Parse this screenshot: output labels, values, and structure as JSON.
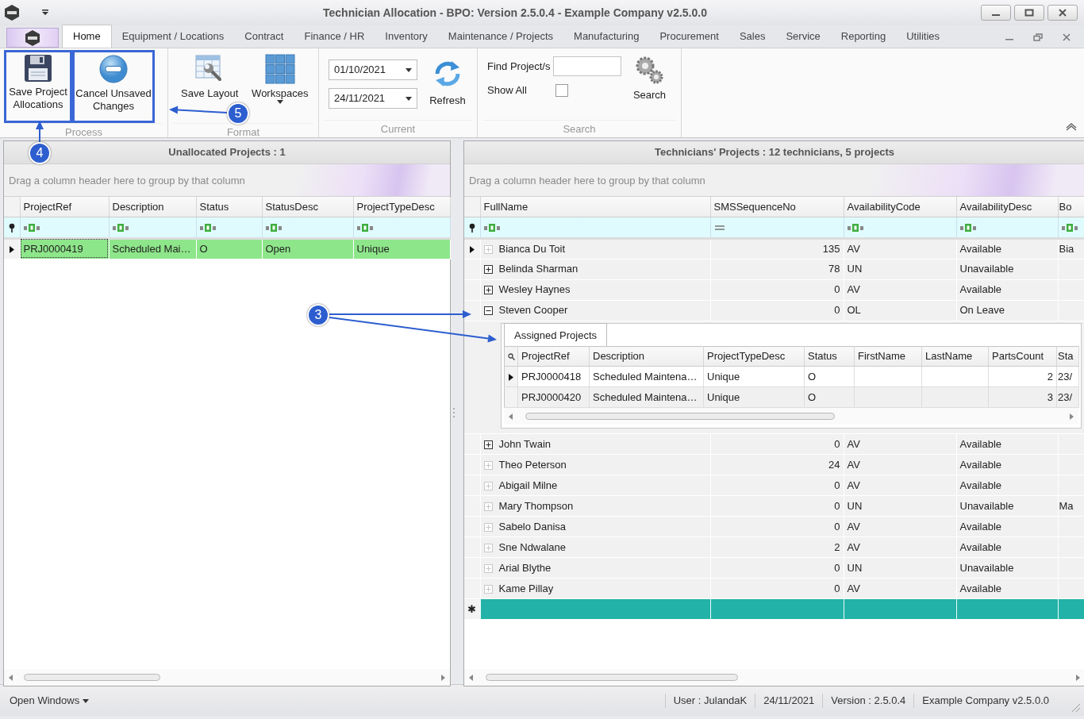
{
  "window": {
    "title": "Technician Allocation - BPO: Version 2.5.0.4 - Example Company v2.5.0.0"
  },
  "ribbon_tabs": [
    {
      "label": "Home",
      "selected": true
    },
    {
      "label": "Equipment / Locations",
      "selected": false
    },
    {
      "label": "Contract",
      "selected": false
    },
    {
      "label": "Finance / HR",
      "selected": false
    },
    {
      "label": "Inventory",
      "selected": false
    },
    {
      "label": "Maintenance / Projects",
      "selected": false
    },
    {
      "label": "Manufacturing",
      "selected": false
    },
    {
      "label": "Procurement",
      "selected": false
    },
    {
      "label": "Sales",
      "selected": false
    },
    {
      "label": "Service",
      "selected": false
    },
    {
      "label": "Reporting",
      "selected": false
    },
    {
      "label": "Utilities",
      "selected": false
    }
  ],
  "ribbon": {
    "process": {
      "label": "Process",
      "buttons": [
        {
          "kind": "save",
          "label": "Save Project Allocations",
          "highlighted": true
        },
        {
          "kind": "cancel",
          "label": "Cancel Unsaved Changes",
          "highlighted": true
        }
      ]
    },
    "format": {
      "label": "Format",
      "buttons": [
        {
          "kind": "layout",
          "label": "Save Layout",
          "dropdown": false
        },
        {
          "kind": "workspaces",
          "label": "Workspaces",
          "dropdown": true
        }
      ]
    },
    "current": {
      "label": "Current",
      "dates": [
        "01/10/2021",
        "24/11/2021"
      ],
      "refresh_label": "Refresh"
    },
    "search": {
      "label": "Search",
      "find_label": "Find Project/s",
      "show_all_label": "Show All",
      "show_all_checked": false,
      "search_label": "Search"
    }
  },
  "unallocated": {
    "caption": "Unallocated Projects : 1",
    "group_hint": "Drag a column header here to group by that column",
    "columns": [
      {
        "label": "ProjectRef",
        "kind": "text"
      },
      {
        "label": "Description",
        "kind": "text"
      },
      {
        "label": "Status",
        "kind": "text"
      },
      {
        "label": "StatusDesc",
        "kind": "text"
      },
      {
        "label": "ProjectTypeDesc",
        "kind": "text"
      }
    ],
    "rows": [
      {
        "selected": true,
        "cells": [
          "PRJ0000419",
          "Scheduled Mai…",
          "O",
          "Open",
          "Unique"
        ]
      }
    ]
  },
  "technicians": {
    "caption": "Technicians' Projects : 12 technicians, 5 projects",
    "group_hint": "Drag a column header here to group by that column",
    "columns": [
      {
        "label": "FullName",
        "kind": "text"
      },
      {
        "label": "SMSSequenceNo",
        "kind": "number"
      },
      {
        "label": "AvailabilityCode",
        "kind": "text"
      },
      {
        "label": "AvailabilityDesc",
        "kind": "text"
      },
      {
        "label": "Bo",
        "kind": "text"
      }
    ],
    "rows": [
      {
        "selected": true,
        "has_details": false,
        "expanded": false,
        "cells": [
          "Bianca Du Toit",
          "135",
          "AV",
          "Available",
          "Bia"
        ]
      },
      {
        "selected": false,
        "has_details": true,
        "expanded": false,
        "cells": [
          "Belinda Sharman",
          "78",
          "UN",
          "Unavailable",
          null
        ]
      },
      {
        "selected": false,
        "has_details": true,
        "expanded": false,
        "cells": [
          "Wesley Haynes",
          "0",
          "AV",
          "Available",
          null
        ]
      },
      {
        "selected": false,
        "has_details": true,
        "expanded": true,
        "cells": [
          "Steven Cooper",
          "0",
          "OL",
          "On Leave",
          null
        ],
        "details": {
          "tab": "Assigned Projects",
          "columns": [
            "ProjectRef",
            "Description",
            "ProjectTypeDesc",
            "Status",
            "FirstName",
            "LastName",
            "PartsCount",
            "Sta"
          ],
          "rows": [
            {
              "selected": true,
              "cells": [
                "PRJ0000418",
                "Scheduled Maintena…",
                "Unique",
                "O",
                null,
                null,
                "2",
                "23/"
              ]
            },
            {
              "selected": false,
              "cells": [
                "PRJ0000420",
                "Scheduled Maintena…",
                "Unique",
                "O",
                null,
                null,
                "3",
                "23/"
              ]
            }
          ]
        }
      },
      {
        "selected": false,
        "has_details": true,
        "expanded": false,
        "cells": [
          "John Twain",
          "0",
          "AV",
          "Available",
          null
        ]
      },
      {
        "selected": false,
        "has_details": false,
        "expanded": false,
        "cells": [
          "Theo Peterson",
          "24",
          "AV",
          "Available",
          null
        ]
      },
      {
        "selected": false,
        "has_details": false,
        "expanded": false,
        "cells": [
          "Abigail Milne",
          "0",
          "AV",
          "Available",
          null
        ]
      },
      {
        "selected": false,
        "has_details": false,
        "expanded": false,
        "cells": [
          "Mary Thompson",
          "0",
          "UN",
          "Unavailable",
          "Ma"
        ]
      },
      {
        "selected": false,
        "has_details": false,
        "expanded": false,
        "cells": [
          "Sabelo Danisa",
          "0",
          "AV",
          "Available",
          null
        ]
      },
      {
        "selected": false,
        "has_details": false,
        "expanded": false,
        "cells": [
          "Sne Ndwalane",
          "2",
          "AV",
          "Available",
          null
        ]
      },
      {
        "selected": false,
        "has_details": false,
        "expanded": false,
        "cells": [
          "Arial Blythe",
          "0",
          "UN",
          "Unavailable",
          null
        ]
      },
      {
        "selected": false,
        "has_details": false,
        "expanded": false,
        "cells": [
          "Kame Pillay",
          "0",
          "AV",
          "Available",
          null
        ]
      }
    ],
    "new_row_marker": "✱"
  },
  "status_bar": {
    "menu": "Open Windows",
    "items": [
      "User : JulandaK",
      "24/11/2021",
      "Version : 2.5.0.4",
      "Example Company v2.5.0.0"
    ]
  },
  "annotations": [
    {
      "number": "5"
    },
    {
      "number": "4"
    },
    {
      "number": "3"
    }
  ]
}
